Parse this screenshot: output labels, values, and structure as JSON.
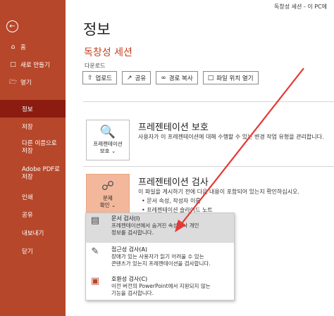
{
  "window": {
    "title": "독창성 세션 - 이 PC에"
  },
  "sidebar": {
    "back_icon": "back-arrow-icon",
    "items": [
      {
        "label": "홈",
        "icon": "home-icon"
      },
      {
        "label": "새로 만들기",
        "icon": "new-file-icon"
      },
      {
        "label": "열기",
        "icon": "folder-icon"
      },
      {
        "label": "정보"
      },
      {
        "label": "저장"
      },
      {
        "label_line1": "다른 이름으로",
        "label_line2": "저장"
      },
      {
        "label_line1": "Adobe PDF로",
        "label_line2": "저장"
      },
      {
        "label": "인쇄"
      },
      {
        "label": "공유"
      },
      {
        "label": "내보내기"
      },
      {
        "label": "닫기"
      }
    ],
    "active_color": "#8c1c10",
    "bg_color": "#b7472a"
  },
  "main": {
    "page_title": "정보",
    "doc_title": "독창성 세션",
    "doc_path": "다운로드",
    "buttons": [
      {
        "label": "업로드",
        "icon": "upload-icon"
      },
      {
        "label": "공유",
        "icon": "share-icon"
      },
      {
        "label": "경로 복사",
        "icon": "link-icon"
      },
      {
        "label": "파일 위치 열기",
        "icon": "folder-icon"
      }
    ],
    "protect": {
      "tile_line1": "프레젠테이션",
      "tile_line2": "보호 ⌄",
      "title": "프레젠테이션 보호",
      "desc": "사용자가 이 프레젠테이션에 대해 수행할 수 있는 변경 작업 유형을 관리합니다."
    },
    "inspect": {
      "tile_line1": "문제",
      "tile_line2": "확인 ⌄",
      "title": "프레젠테이션 검사",
      "desc": "이 파일을 게시하기 전에 다음 내용이 포함되어 있는지 확인하십시오.",
      "bullets": [
        "문서 속성, 작성자 이름",
        "프레젠테이션 슬라이드 노트"
      ]
    }
  },
  "menu": {
    "items": [
      {
        "title": "문서 검사(I)",
        "desc1": "프레젠테이션에서 숨겨진 속성이나 개인",
        "desc2": "정보를 검사합니다."
      },
      {
        "title": "접근성 검사(A)",
        "desc1": "장애가 있는 사용자가 읽기 어려울 수 있는",
        "desc2": "콘텐츠가 있는지 프레젠테이션을 검사합니다."
      },
      {
        "title": "호환성 검사(C)",
        "desc1": "이전 버전의 PowerPoint에서 지원되지 않는",
        "desc2": "기능을 검사합니다."
      }
    ]
  },
  "annotation": {
    "color": "#e53935"
  }
}
